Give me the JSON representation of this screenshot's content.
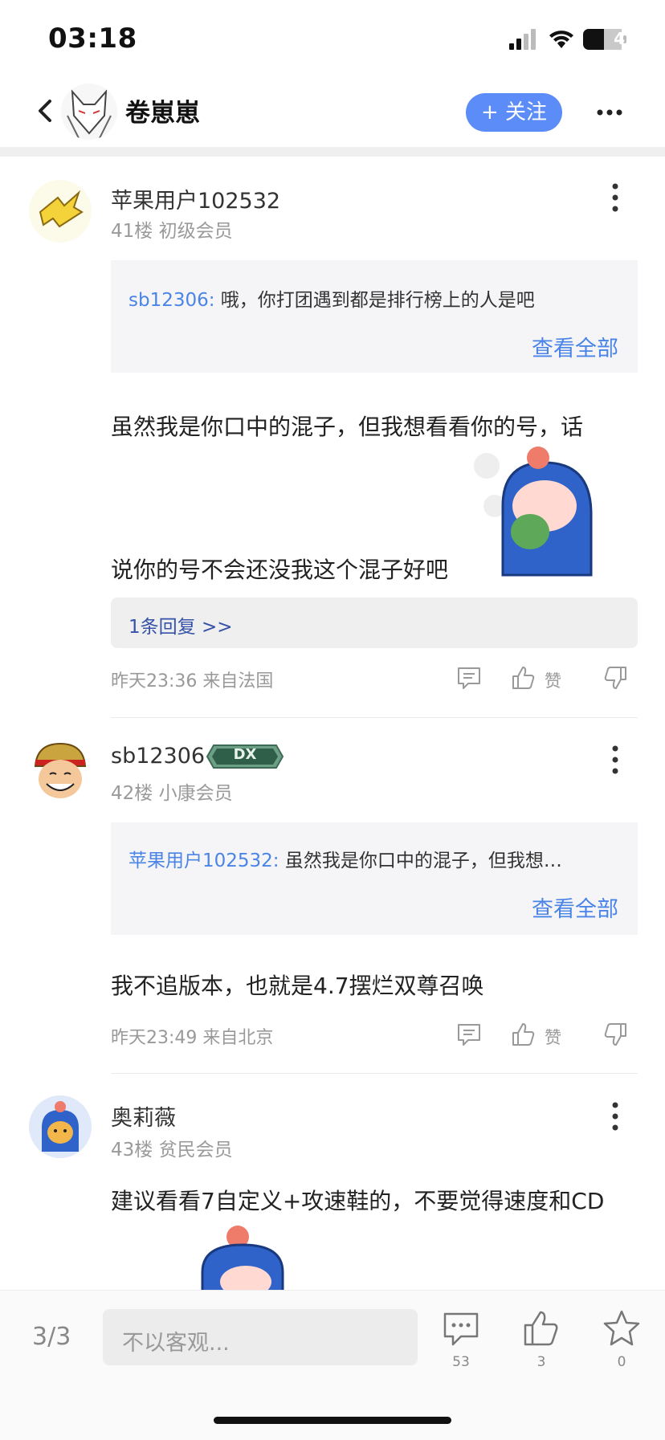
{
  "status": {
    "time": "03:18",
    "battery": "41"
  },
  "header": {
    "title": "卷崽崽",
    "follow_label": "+ 关注"
  },
  "comments": [
    {
      "username": "苹果用户102532",
      "floor": "41楼  初级会员",
      "quote_user": "sb12306:",
      "quote_text": " 哦，你打团遇到都是排行榜上的人是吧",
      "see_all": "查看全部",
      "content_line1": "虽然我是你口中的混子，但我想看看你的号，话",
      "content_line2": "说你的号不会还没我这个混子好吧",
      "reply_link": "1条回复 >>",
      "meta": "昨天23:36  来自法国",
      "like_label": "赞"
    },
    {
      "username": "sb12306",
      "badge": "DX",
      "floor": "42楼  小康会员",
      "quote_user": "苹果用户102532:",
      "quote_text": " 虽然我是你口中的混子，但我想…",
      "see_all": "查看全部",
      "content_line1": "我不追版本，也就是4.7摆烂双尊召唤",
      "meta": "昨天23:49  来自北京",
      "like_label": "赞"
    },
    {
      "username": "奥莉薇",
      "floor": "43楼  贫民会员",
      "content_line1": "建议看看7自定义+攻速鞋的，不要觉得速度和CD"
    }
  ],
  "bottom": {
    "page": "3/3",
    "placeholder": "不以客观...",
    "comment_count": "53",
    "like_count": "3",
    "fav_count": "0"
  }
}
